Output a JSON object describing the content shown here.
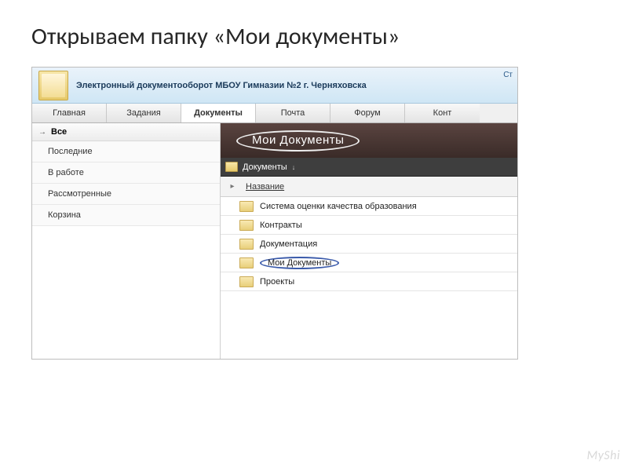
{
  "slide": {
    "title": "Открываем папку «Мои документы»"
  },
  "header": {
    "title": "Электронный документооборот МБОУ Гимназии №2 г. Черняховска",
    "right": "Ст"
  },
  "tabs": [
    {
      "label": "Главная",
      "active": false
    },
    {
      "label": "Задания",
      "active": false
    },
    {
      "label": "Документы",
      "active": true
    },
    {
      "label": "Почта",
      "active": false
    },
    {
      "label": "Форум",
      "active": false
    },
    {
      "label": "Конт",
      "active": false
    }
  ],
  "sidebar": {
    "header": "Все",
    "items": [
      {
        "label": "Последние"
      },
      {
        "label": "В работе"
      },
      {
        "label": "Рассмотренные"
      },
      {
        "label": "Корзина"
      }
    ]
  },
  "panel": {
    "title": "Мои Документы",
    "breadcrumb": "Документы",
    "column": "Название",
    "rows": [
      {
        "label": "Система оценки качества образования",
        "highlight": false
      },
      {
        "label": "Контракты",
        "highlight": false
      },
      {
        "label": "Документация",
        "highlight": false
      },
      {
        "label": "Мои Документы",
        "highlight": true
      },
      {
        "label": "Проекты",
        "highlight": false
      }
    ]
  },
  "watermark": "MyShi"
}
